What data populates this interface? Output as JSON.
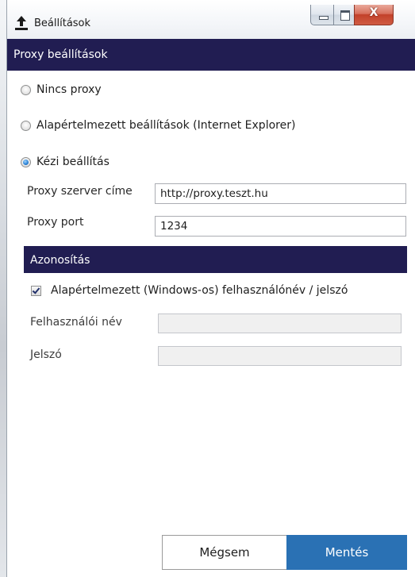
{
  "window": {
    "title": "Beállítások",
    "app_icon": "upload-arrow-icon",
    "controls": {
      "minimize": "minimize-icon",
      "maximize": "maximize-icon",
      "close": "close-icon"
    },
    "close_glyph": "X"
  },
  "proxy_section": {
    "title": "Proxy beállítások",
    "options": [
      {
        "label": "Nincs proxy",
        "checked": false
      },
      {
        "label": "Alapértelmezett beállítások (Internet Explorer)",
        "checked": false
      },
      {
        "label": "Kézi beállítás",
        "checked": true
      }
    ],
    "server_label": "Proxy szerver címe",
    "server_value": "http://proxy.teszt.hu",
    "port_label": "Proxy port",
    "port_value": "1234"
  },
  "auth_section": {
    "title": "Azonosítás",
    "default_credentials_label": "Alapértelmezett (Windows-os) felhasználónév / jelszó",
    "default_credentials_checked": true,
    "username_label": "Felhasználói név",
    "username_value": "",
    "password_label": "Jelszó",
    "password_value": ""
  },
  "footer": {
    "cancel_label": "Mégsem",
    "save_label": "Mentés"
  },
  "colors": {
    "header_bg": "#211d52",
    "save_bg": "#2a71b4",
    "close_btn": "#c2412a"
  }
}
